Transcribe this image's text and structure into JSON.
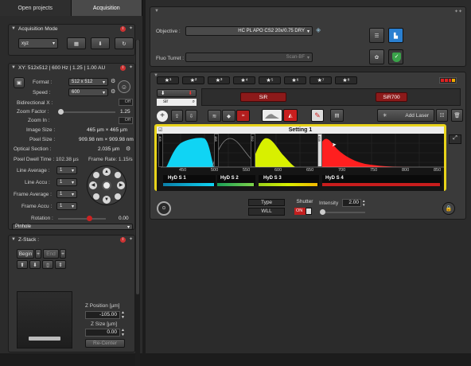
{
  "tabs": [
    "Open projects",
    "Acquisition"
  ],
  "acq_mode": {
    "title": "Acquisition Mode",
    "mode": "xyz"
  },
  "xy": {
    "title": "XY: 512x512 | 600 Hz | 1.25 | 1.00 AU",
    "format_label": "Format :",
    "format_value": "512 x 512",
    "speed_label": "Speed :",
    "speed_value": "600",
    "bidir_label": "Bidirectional X :",
    "bidir_state": "Off",
    "zoom_factor_label": "Zoom Factor :",
    "zoom_factor_value": "1.25",
    "zoom_in_label": "Zoom In :",
    "zoom_in_state": "Off",
    "image_size_label": "Image Size :",
    "image_size_value": "465 µm × 465 µm",
    "pixel_size_label": "Pixel Size :",
    "pixel_size_value": "909.98 nm × 909.98 nm",
    "optical_section_label": "Optical Section :",
    "optical_section_value": "2.035 µm",
    "pixel_dwell": "Pixel Dwell Time : 102.38 µs",
    "frame_rate": "Frame Rate: 1.15/s",
    "line_average_label": "Line Average :",
    "line_average_value": "1",
    "line_accu_label": "Line Accu :",
    "line_accu_value": "1",
    "frame_average_label": "Frame Average :",
    "frame_average_value": "1",
    "frame_accu_label": "Frame Accu :",
    "frame_accu_value": "1",
    "rotation_label": "Rotation :",
    "rotation_value": "0.00",
    "pinhole": "Pinhole"
  },
  "zstack": {
    "title": "Z-Stack :",
    "begin": "Begin",
    "end": "End",
    "zpos_label": "Z Position [µm]",
    "zpos_value": "-105.00",
    "zsize_label": "Z Size [µm]",
    "zsize_value": "0.00",
    "recenter": "Re-Center"
  },
  "objective": {
    "label": "Objective :",
    "value": "HC PL APO CS2   20x/0.75 DRY"
  },
  "fluo": {
    "label": "Fluo Turret :",
    "value": "Scan-BF"
  },
  "beam": {
    "stars": [
      "★¹",
      "★²",
      "★³",
      "★⁴",
      "★⁵",
      "★⁶",
      "★⁷",
      "★⁸"
    ],
    "search_value": "sir",
    "lasers": [
      "SiR",
      "SiR700"
    ],
    "add_laser": "Add Laser",
    "setting_title": "Setting 1",
    "marker_labels": [
      "405",
      "488",
      "552",
      "638"
    ],
    "axis_ticks": [
      "450",
      "500",
      "550",
      "600",
      "650",
      "700",
      "750",
      "800",
      "850"
    ],
    "detectors": [
      "HyD S 1",
      "HyD S 2",
      "HyD S 3",
      "HyD S 4"
    ],
    "type_label": "Type",
    "type_value": "WLL",
    "shutter_label": "Shutter",
    "shutter_state": "ON",
    "intensity_label": "Intensity",
    "intensity_value": "2.00"
  },
  "colors": {
    "cyan": "#10d4f4",
    "yellow": "#d8f000",
    "red": "#ff1f1f",
    "highlight": "#e8d31a"
  }
}
